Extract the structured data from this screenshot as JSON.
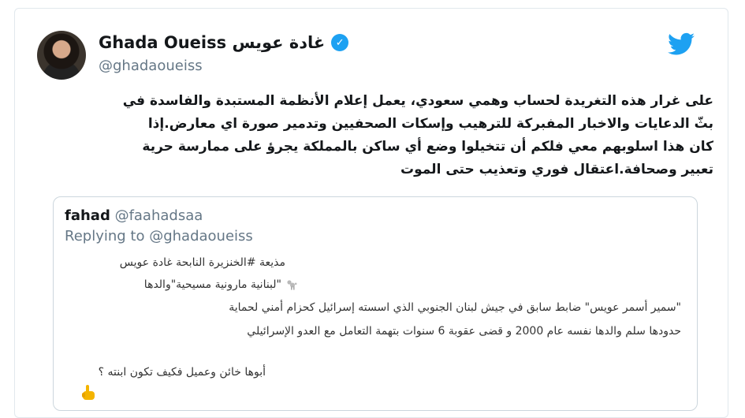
{
  "author": {
    "display_name": "Ghada Oueiss غادة عويس",
    "handle": "@ghadaoueiss",
    "verified": true,
    "avatar_icon": "profile-photo-avatar"
  },
  "brand": {
    "icon": "twitter-bird-icon",
    "color": "#1da1f2"
  },
  "tweet": {
    "lines": [
      "على غرار هذه التغريدة لحساب وهمي سعودي، يعمل إعلام الأنظمة المستبدة والفاسدة في",
      "بثّ الدعايات والاخبار المفبركة للترهيب وإسكات الصحفيين وتدمير صورة اي معارض.إذا",
      "كان هذا اسلوبهم معي فلكم أن تتخيلوا وضع أي ساكن بالمملكة يجرؤ على ممارسة حرية",
      "تعبير وصحافة.اعتقال فوري وتعذيب حتى الموت"
    ]
  },
  "quoted": {
    "display_name": "fahad",
    "handle": "@faahadsaa",
    "replying_to": "Replying to @ghadaoueiss",
    "lines": [
      "مذيعة #الخنزيرة النابحة غادة عويس",
      "\"لبنانية مارونية مسيحية\"والدها",
      "\"سمير أسمر عويس\" ضابط سابق في جيش لبنان الجنوبي الذي اسسته إسرائيل كحزام أمني لحماية",
      "حدودها  سلم والدها نفسه عام 2000 و قضى عقوبة 6 سنوات بتهمة التعامل مع العدو الإسرائيلي",
      "أبوها خائن وعميل فكيف تكون ابنته ؟"
    ],
    "icons": [
      "poodle-icon",
      "pointing-finger-icon"
    ]
  }
}
